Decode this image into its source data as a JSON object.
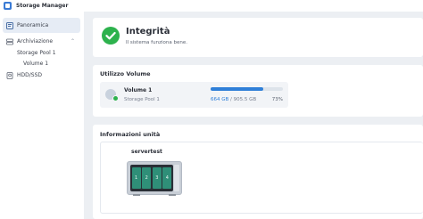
{
  "app": {
    "title": "Storage Manager"
  },
  "sidebar": {
    "items": [
      {
        "label": "Panoramica"
      },
      {
        "label": "Archiviazione"
      },
      {
        "label": "HDD/SSD"
      }
    ],
    "subitems": [
      {
        "label": "Storage Pool 1"
      },
      {
        "label": "Volume 1"
      }
    ]
  },
  "health": {
    "title": "Integrità",
    "subtitle": "Il sistema funziona bene."
  },
  "volume_usage": {
    "section_title": "Utilizzo Volume",
    "volume_name": "Volume 1",
    "pool_name": "Storage Pool 1",
    "used": "664 GB",
    "total": "/ 905.5 GB",
    "percent": "73%",
    "fill_fraction": 0.73
  },
  "unit_info": {
    "section_title": "Informazioni unità",
    "server_name": "servertest",
    "bays": [
      "1",
      "2",
      "3",
      "4"
    ]
  },
  "colors": {
    "accent": "#2f7fd8",
    "ok": "#2db24d"
  }
}
